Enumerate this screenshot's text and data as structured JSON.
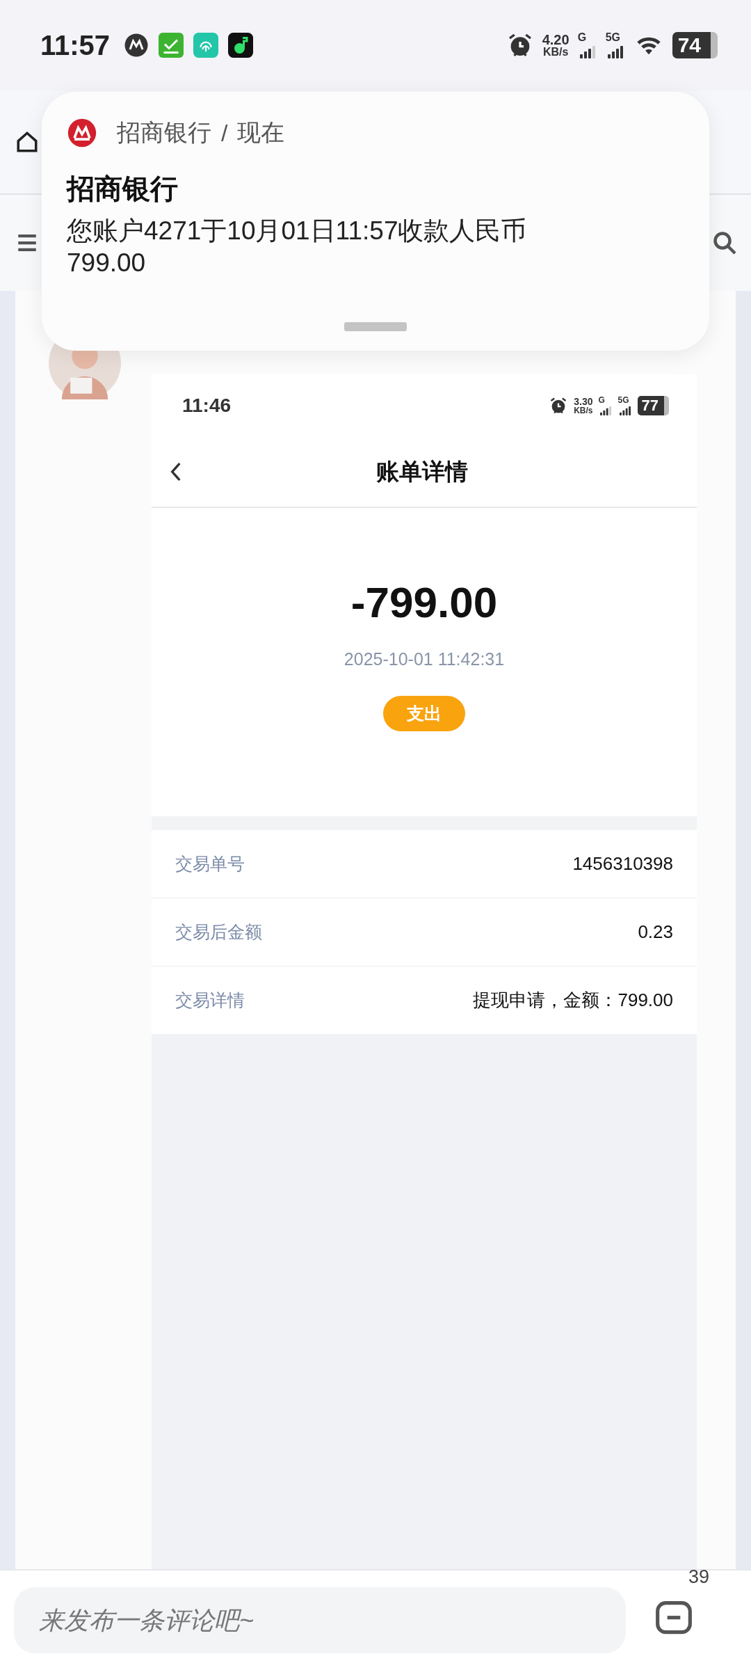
{
  "status_bar": {
    "time": "11:57",
    "speed": "4.20",
    "speed_unit": "KB/s",
    "network_1": "G",
    "network_2": "5G",
    "battery": "74"
  },
  "notification": {
    "app": "招商银行",
    "separator": "/",
    "when": "现在",
    "title": "招商银行",
    "body": "您账户4271于10月01日11:57收款人民币799.00"
  },
  "post": {
    "screenshot": {
      "status_bar": {
        "time": "11:46",
        "speed": "3.30",
        "speed_unit": "KB/s",
        "network_1": "G",
        "network_2": "5G",
        "battery": "77"
      },
      "title": "账单详情",
      "amount": "-799.00",
      "datetime": "2025-10-01 11:42:31",
      "badge": "支出",
      "rows": [
        {
          "label": "交易单号",
          "value": "1456310398"
        },
        {
          "label": "交易后金额",
          "value": "0.23"
        },
        {
          "label": "交易详情",
          "value": "提现申请，金额：799.00"
        }
      ]
    }
  },
  "comment_bar": {
    "placeholder": "来发布一条评论吧~",
    "count": "39"
  }
}
